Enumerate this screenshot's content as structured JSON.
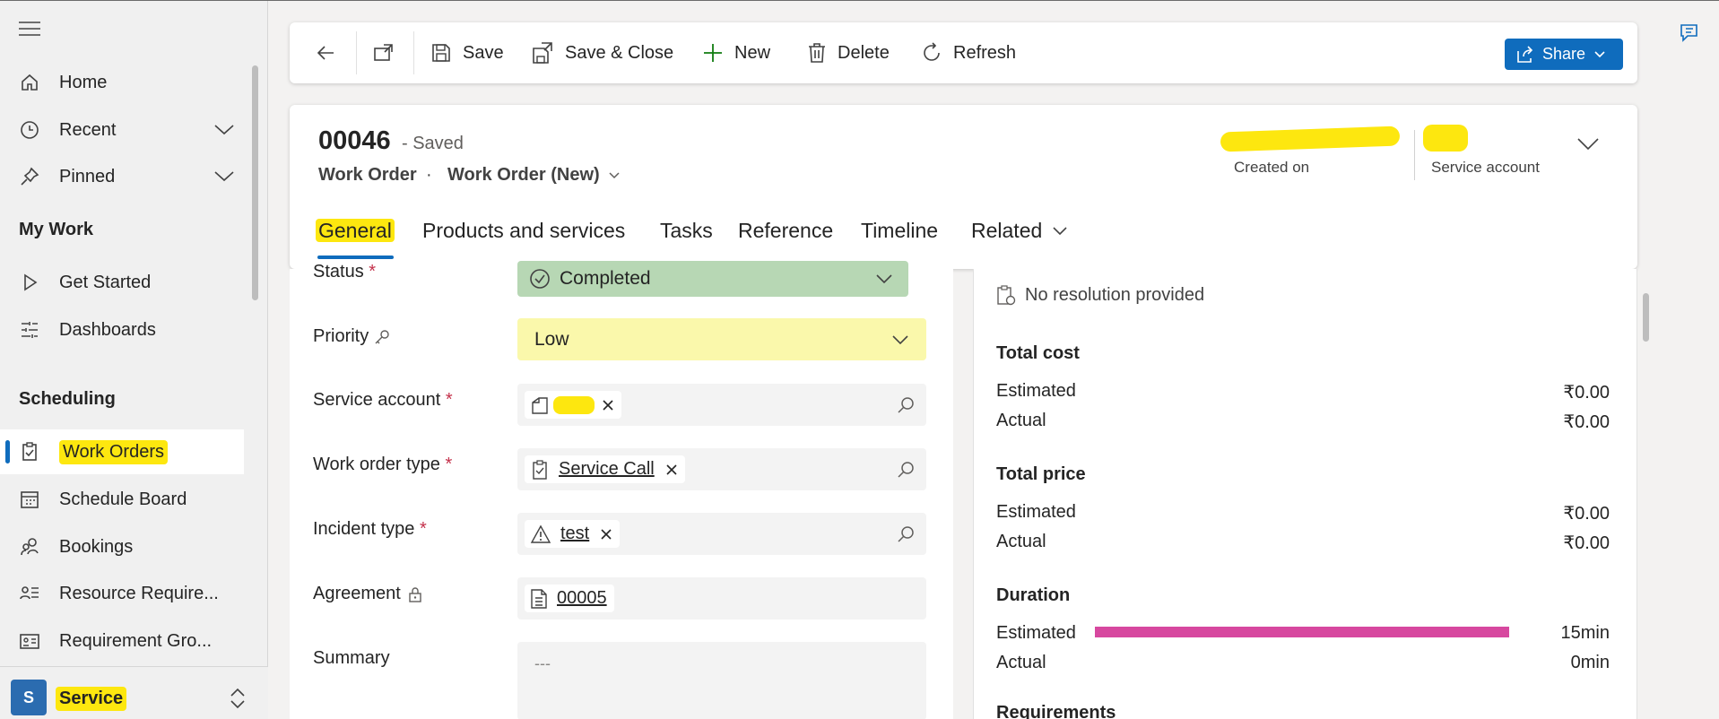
{
  "sidebar": {
    "items": {
      "home": "Home",
      "recent": "Recent",
      "pinned": "Pinned",
      "get_started": "Get Started",
      "dashboards": "Dashboards",
      "work_orders": "Work Orders",
      "schedule_board": "Schedule Board",
      "bookings": "Bookings",
      "resource_requirements": "Resource Require...",
      "requirement_groups": "Requirement Gro..."
    },
    "groups": {
      "my_work": "My Work",
      "scheduling": "Scheduling"
    },
    "area": {
      "initial": "S",
      "label": "Service"
    }
  },
  "toolbar": {
    "save": "Save",
    "save_close": "Save & Close",
    "new": "New",
    "delete": "Delete",
    "refresh": "Refresh",
    "share": "Share"
  },
  "record": {
    "number": "00046",
    "status": "- Saved",
    "entity": "Work Order",
    "separator": "·",
    "form_name": "Work Order (New)",
    "created_on_label": "Created on",
    "service_account_label": "Service account"
  },
  "tabs": {
    "general": "General",
    "products": "Products and services",
    "tasks": "Tasks",
    "reference": "Reference",
    "timeline": "Timeline",
    "related": "Related"
  },
  "form": {
    "status": {
      "label": "Status",
      "value": "Completed"
    },
    "priority": {
      "label": "Priority",
      "value": "Low"
    },
    "service_account": {
      "label": "Service account"
    },
    "work_order_type": {
      "label": "Work order type",
      "value": "Service Call"
    },
    "incident_type": {
      "label": "Incident type",
      "value": "test"
    },
    "agreement": {
      "label": "Agreement",
      "value": "00005"
    },
    "summary": {
      "label": "Summary",
      "value": "---"
    },
    "required_mark": "*"
  },
  "summary_panel": {
    "resolution": "No resolution provided",
    "total_cost": {
      "title": "Total cost",
      "estimated_label": "Estimated",
      "estimated": "₹0.00",
      "actual_label": "Actual",
      "actual": "₹0.00"
    },
    "total_price": {
      "title": "Total price",
      "estimated_label": "Estimated",
      "estimated": "₹0.00",
      "actual_label": "Actual",
      "actual": "₹0.00"
    },
    "duration": {
      "title": "Duration",
      "estimated_label": "Estimated",
      "estimated": "15min",
      "estimated_fill": 1.0,
      "actual_label": "Actual",
      "actual": "0min"
    },
    "requirements_title": "Requirements"
  },
  "colors": {
    "accent": "#0f6cbd",
    "highlight": "#fde70f",
    "status_completed": "#b7d7b4",
    "priority_low": "#faf8ab",
    "duration_bar": "#d7489f"
  }
}
